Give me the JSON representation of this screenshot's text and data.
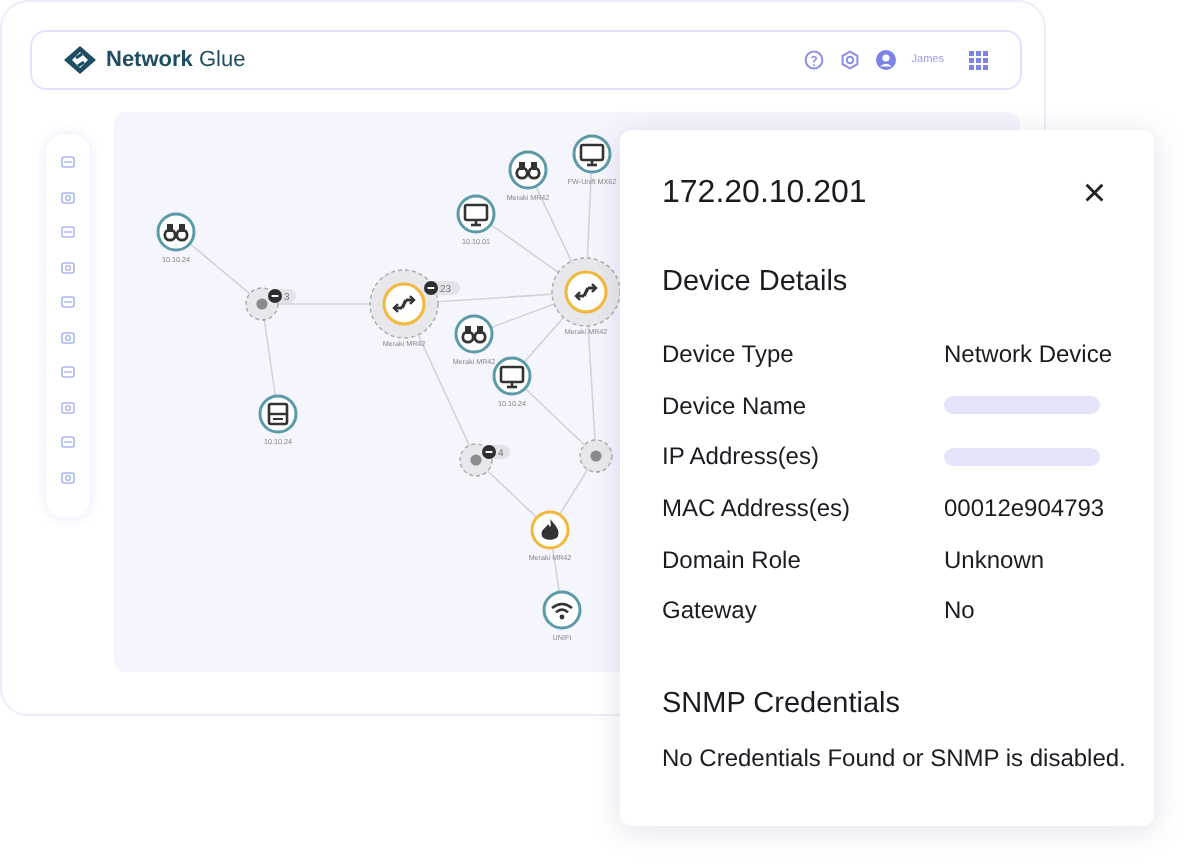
{
  "header": {
    "brand": "**Network** Glue",
    "user": "James"
  },
  "graph": {
    "nodes": [
      {
        "kind": "binoculars",
        "label": "10.10.24",
        "highlighted": false
      },
      {
        "kind": "cluster",
        "count": "3"
      },
      {
        "kind": "server",
        "label": "10.10.24",
        "highlighted": false
      },
      {
        "kind": "switch",
        "label": "Meraki MR42",
        "count": "23",
        "highlighted": true
      },
      {
        "kind": "binoculars",
        "label": "Meraki MR42",
        "highlighted": false
      },
      {
        "kind": "monitor",
        "label": "FW-Unifi MX62",
        "highlighted": false
      },
      {
        "kind": "monitor",
        "label": "10.10.01",
        "highlighted": false
      },
      {
        "kind": "switch",
        "label": "Meraki MR42",
        "highlighted": true
      },
      {
        "kind": "binoculars",
        "label": "Meraki MR42",
        "highlighted": false
      },
      {
        "kind": "monitor",
        "label": "10.10.24",
        "highlighted": false
      },
      {
        "kind": "cluster",
        "count": "4"
      },
      {
        "kind": "cluster"
      },
      {
        "kind": "flame",
        "label": "Meraki MR42",
        "highlighted": true
      },
      {
        "kind": "wifi",
        "label": "UNIFI",
        "highlighted": false
      }
    ]
  },
  "details": {
    "title": "172.20.10.201",
    "close": "×",
    "section": "Device Details",
    "rows": [
      {
        "label": "Device Type",
        "value": "Network Device"
      },
      {
        "label": "Device Name",
        "redacted": true
      },
      {
        "label": "IP Address(es)",
        "redacted": true
      },
      {
        "label": "MAC Address(es)",
        "value": "00012e904793"
      },
      {
        "label": "Domain Role",
        "value": "Unknown"
      },
      {
        "label": "Gateway",
        "value": "No"
      }
    ],
    "snmp_title": "SNMP Credentials",
    "snmp_message": "No Credentials Found or SNMP is disabled."
  }
}
